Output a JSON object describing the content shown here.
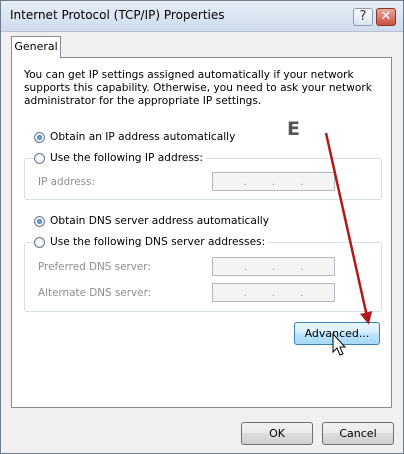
{
  "window": {
    "title": "Internet Protocol (TCP/IP) Properties",
    "help_glyph": "?",
    "close_glyph": "✕"
  },
  "tabs": [
    {
      "label": "General"
    }
  ],
  "general": {
    "intro": "You can get IP settings assigned automatically if your network supports this capability. Otherwise, you need to ask your network administrator for the appropriate IP settings.",
    "ip": {
      "auto_label": "Obtain an IP address automatically",
      "auto_selected": true,
      "manual_label": "Use the following IP address:",
      "ip_address_label": "IP address:",
      "ip_address_value": ". . ."
    },
    "dns": {
      "auto_label": "Obtain DNS server address automatically",
      "auto_selected": true,
      "manual_label": "Use the following DNS server addresses:",
      "preferred_label": "Preferred DNS server:",
      "preferred_value": ". . .",
      "alternate_label": "Alternate DNS server:",
      "alternate_value": ". . ."
    },
    "advanced_label": "Advanced..."
  },
  "footer": {
    "ok_label": "OK",
    "cancel_label": "Cancel"
  },
  "annotation": {
    "letter": "E",
    "arrow_color": "#b11a1a"
  }
}
